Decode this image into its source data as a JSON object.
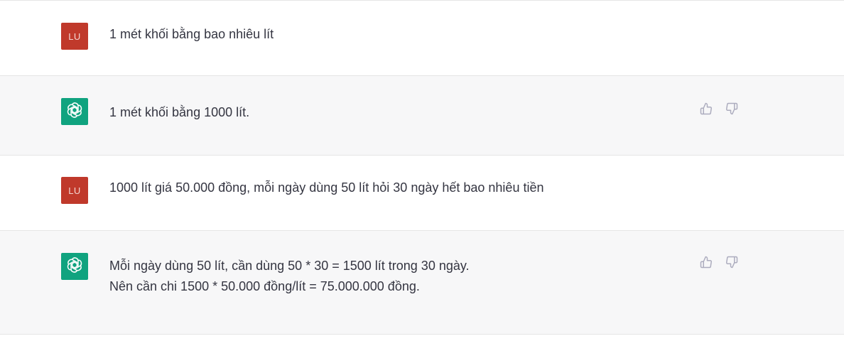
{
  "conversation": {
    "messages": [
      {
        "role": "user",
        "avatar_initials": "LU",
        "text": "1 mét khối bằng bao nhiêu lít"
      },
      {
        "role": "assistant",
        "avatar_icon": "openai-logo-icon",
        "lines": [
          "1 mét khối bằng 1000 lít."
        ],
        "feedback": [
          "thumbs-up-icon",
          "thumbs-down-icon"
        ]
      },
      {
        "role": "user",
        "avatar_initials": "LU",
        "text": "1000 lít giá 50.000 đồng, mỗi ngày dùng 50 lít hỏi 30 ngày hết bao nhiêu tiền"
      },
      {
        "role": "assistant",
        "avatar_icon": "openai-logo-icon",
        "lines": [
          "Mỗi ngày dùng 50 lít, cần dùng 50 * 30 = 1500 lít trong 30 ngày.",
          "Nên cần chi 1500 * 50.000 đồng/lít = 75.000.000 đồng."
        ],
        "feedback": [
          "thumbs-up-icon",
          "thumbs-down-icon"
        ]
      }
    ]
  },
  "colors": {
    "user_avatar": "#c0392b",
    "assistant_avatar": "#10a37f",
    "assistant_row_bg": "#f7f7f8",
    "text": "#343541"
  }
}
